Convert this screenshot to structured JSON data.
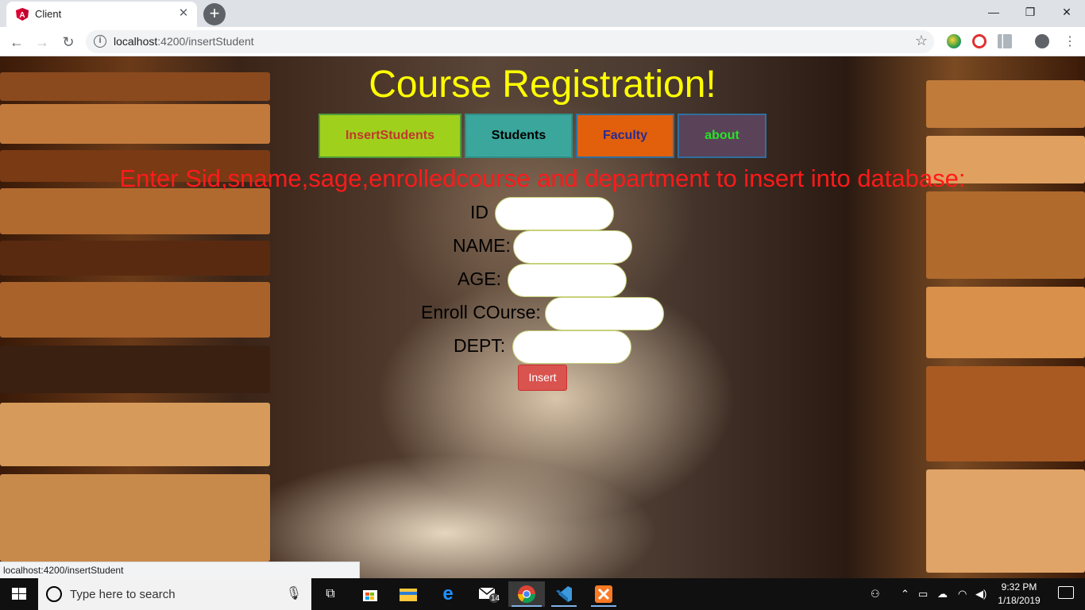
{
  "browser": {
    "tab_title": "Client",
    "tab_close": "✕",
    "new_tab": "+",
    "url_host": "localhost",
    "url_path": ":4200/insertStudent",
    "status_url": "localhost:4200/insertStudent",
    "window_controls": {
      "minimize": "—",
      "restore": "❐",
      "close": "✕"
    },
    "nav": {
      "back": "←",
      "forward": "→",
      "reload": "↻"
    },
    "star": "☆"
  },
  "page": {
    "title": "Course Registration!",
    "nav": [
      {
        "label": "InsertStudents"
      },
      {
        "label": "Students"
      },
      {
        "label": "Faculty"
      },
      {
        "label": "about"
      }
    ],
    "instruction": "Enter Sid,sname,sage,enrolledcourse and department to insert into database:",
    "form": {
      "id_label": "ID",
      "name_label": "NAME:",
      "age_label": "AGE:",
      "course_label": "Enroll COurse:",
      "dept_label": "DEPT:",
      "id_value": "",
      "name_value": "",
      "age_value": "",
      "course_value": "",
      "dept_value": "",
      "submit_label": "Insert"
    }
  },
  "taskbar": {
    "search_placeholder": "Type here to search",
    "mail_badge": "14",
    "time": "9:32 PM",
    "date": "1/18/2019"
  }
}
